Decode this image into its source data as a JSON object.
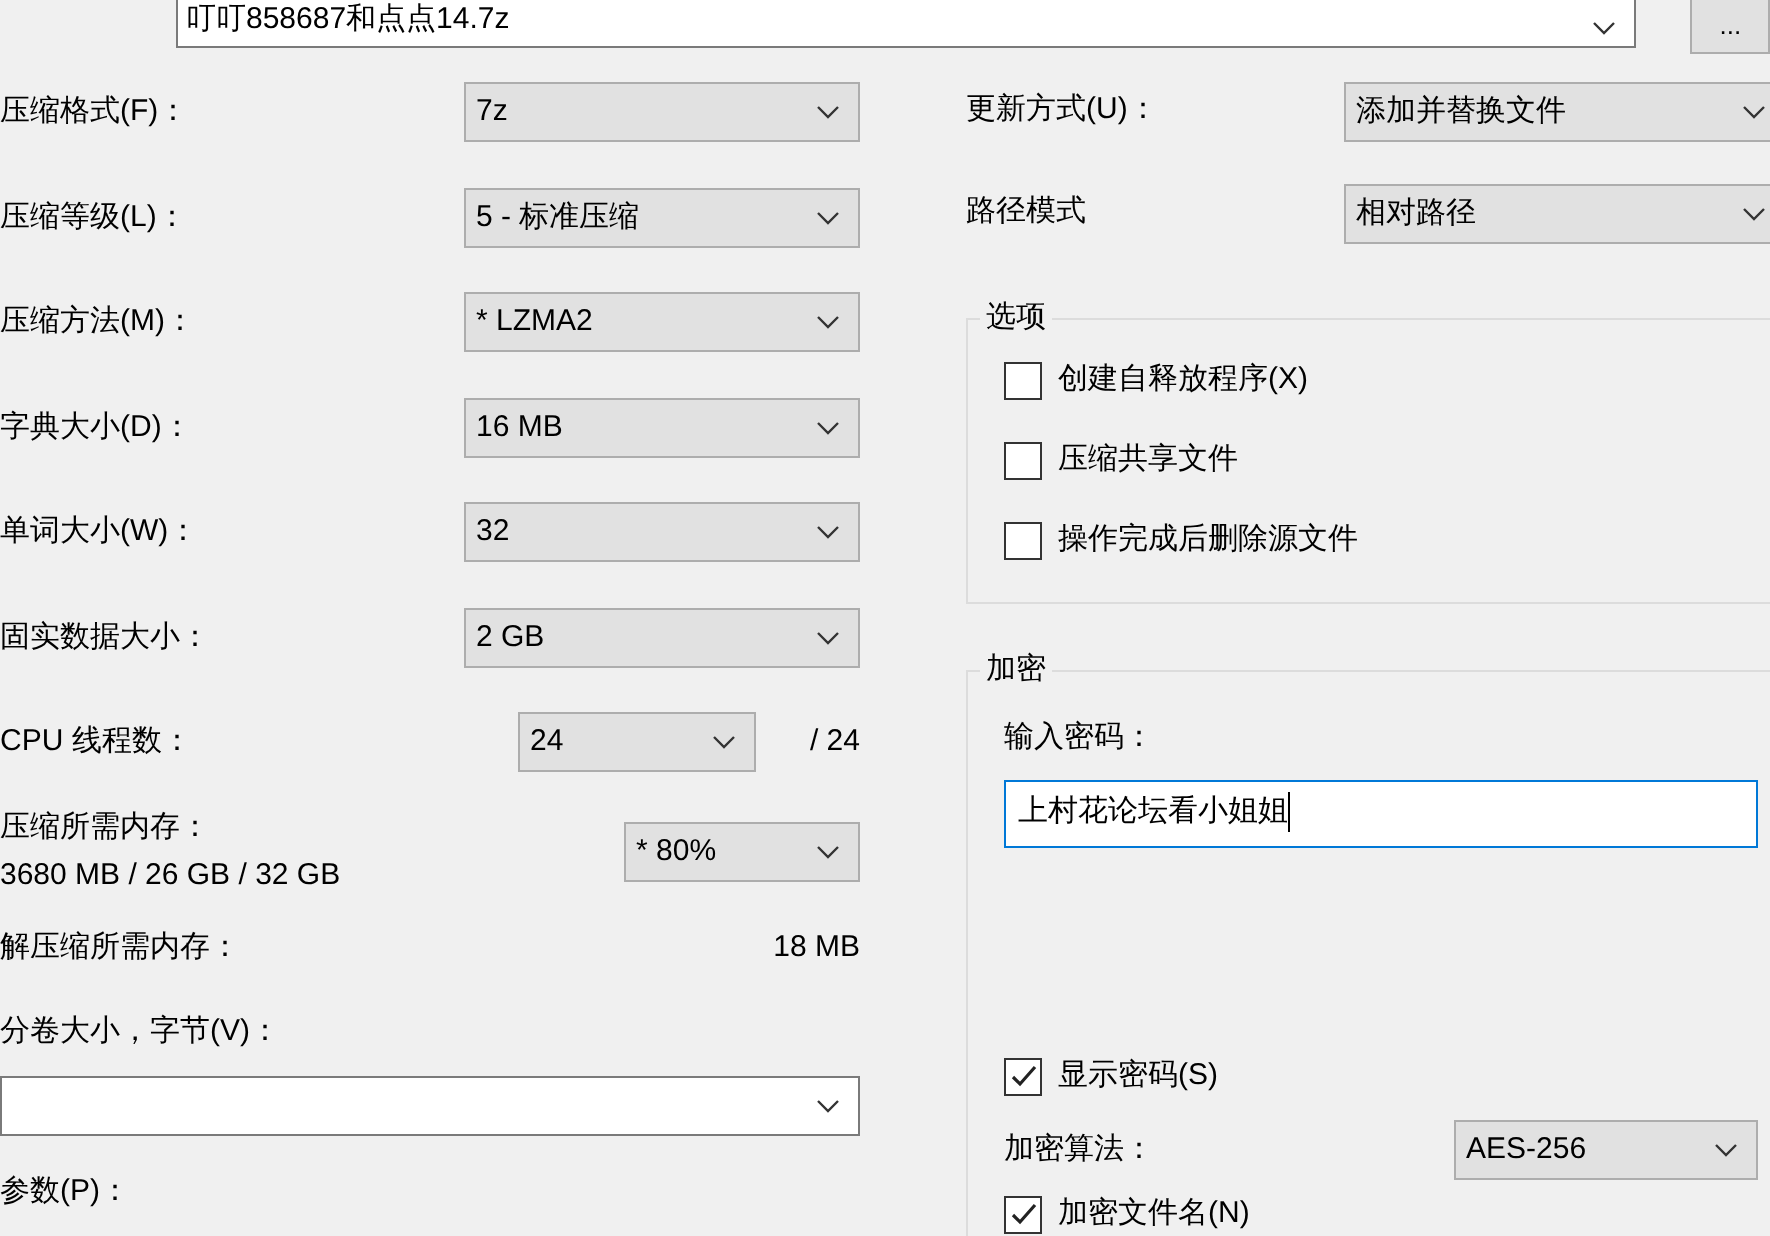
{
  "archive": {
    "value": "叮叮858687和点点14.7z"
  },
  "browse_button": "...",
  "left_fields": [
    {
      "kind": "combo",
      "label": "压缩格式(F)：",
      "value": "7z"
    },
    {
      "kind": "combo",
      "label": "压缩等级(L)：",
      "value": "5 - 标准压缩"
    },
    {
      "kind": "combo",
      "label": "压缩方法(M)：",
      "value": "*  LZMA2"
    },
    {
      "kind": "combo",
      "label": "字典大小(D)：",
      "value": "16 MB"
    },
    {
      "kind": "combo",
      "label": "单词大小(W)：",
      "value": "32"
    },
    {
      "kind": "combo",
      "label": "固实数据大小：",
      "value": "2 GB"
    },
    {
      "kind": "short_combo",
      "label": "CPU 线程数：",
      "value": "24",
      "note": "/ 24"
    },
    {
      "kind": "memory",
      "label": "压缩所需内存：",
      "detail": "3680 MB / 26 GB / 32 GB",
      "value": "*  80%"
    },
    {
      "kind": "readout",
      "label": "解压缩所需内存：",
      "note": "18 MB"
    },
    {
      "kind": "wide_combo",
      "label": "分卷大小，字节(V)："
    },
    {
      "kind": "label",
      "label": "参数(P)："
    }
  ],
  "right_fields": [
    {
      "label": "更新方式(U)：",
      "value": "添加并替换文件"
    },
    {
      "label": "路径模式",
      "value": "相对路径"
    }
  ],
  "options": {
    "title": "选项",
    "items": [
      {
        "label": "创建自释放程序(X)",
        "checked": false
      },
      {
        "label": "压缩共享文件",
        "checked": false
      },
      {
        "label": "操作完成后删除源文件",
        "checked": false
      }
    ]
  },
  "encryption": {
    "title": "加密",
    "password_label": "输入密码：",
    "password": "上村花论坛看小姐姐",
    "show_password": {
      "label": "显示密码(S)",
      "checked": true
    },
    "method_label": "加密算法：",
    "method": "AES-256",
    "encrypt_names": {
      "label": "加密文件名(N)",
      "checked": true
    }
  }
}
